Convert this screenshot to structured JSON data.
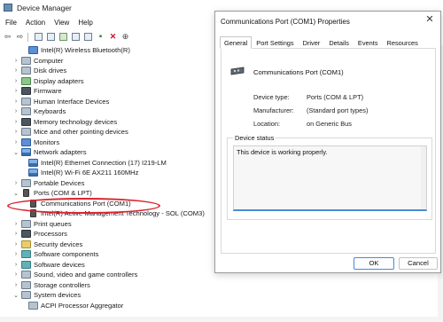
{
  "window": {
    "title": "Device Manager"
  },
  "menu": [
    "File",
    "Action",
    "View",
    "Help"
  ],
  "tree": [
    {
      "label": "Intel(R) Wireless Bluetooth(R)",
      "indent": 2,
      "icon": "bluetooth-icon"
    },
    {
      "label": "Computer",
      "indent": 1,
      "expander": "›",
      "icon": "computer-icon"
    },
    {
      "label": "Disk drives",
      "indent": 1,
      "expander": "›",
      "icon": "disk-drive-icon"
    },
    {
      "label": "Display adapters",
      "indent": 1,
      "expander": "›",
      "icon": "display-adapter-icon"
    },
    {
      "label": "Firmware",
      "indent": 1,
      "expander": "›",
      "icon": "firmware-icon"
    },
    {
      "label": "Human Interface Devices",
      "indent": 1,
      "expander": "›",
      "icon": "hid-icon"
    },
    {
      "label": "Keyboards",
      "indent": 1,
      "expander": "›",
      "icon": "keyboard-icon"
    },
    {
      "label": "Memory technology devices",
      "indent": 1,
      "expander": "›",
      "icon": "memory-icon"
    },
    {
      "label": "Mice and other pointing devices",
      "indent": 1,
      "expander": "›",
      "icon": "mouse-icon"
    },
    {
      "label": "Monitors",
      "indent": 1,
      "expander": "›",
      "icon": "monitor-icon"
    },
    {
      "label": "Network adapters",
      "indent": 1,
      "expander": "⌄",
      "icon": "network-adapter-icon"
    },
    {
      "label": "Intel(R) Ethernet Connection (17) I219-LM",
      "indent": 2,
      "icon": "network-adapter-icon"
    },
    {
      "label": "Intel(R) Wi-Fi 6E AX211 160MHz",
      "indent": 2,
      "icon": "network-adapter-icon"
    },
    {
      "label": "Portable Devices",
      "indent": 1,
      "expander": "›",
      "icon": "portable-device-icon"
    },
    {
      "label": "Ports (COM & LPT)",
      "indent": 1,
      "expander": "⌄",
      "icon": "port-icon"
    },
    {
      "label": "Communications Port (COM1)",
      "indent": 2,
      "icon": "port-icon"
    },
    {
      "label": "Intel(R) Active Management Technology - SOL (COM3)",
      "indent": 2,
      "icon": "port-icon"
    },
    {
      "label": "Print queues",
      "indent": 1,
      "expander": "›",
      "icon": "printer-icon"
    },
    {
      "label": "Processors",
      "indent": 1,
      "expander": "›",
      "icon": "processor-icon"
    },
    {
      "label": "Security devices",
      "indent": 1,
      "expander": "›",
      "icon": "security-icon"
    },
    {
      "label": "Software components",
      "indent": 1,
      "expander": "›",
      "icon": "software-component-icon"
    },
    {
      "label": "Software devices",
      "indent": 1,
      "expander": "›",
      "icon": "software-device-icon"
    },
    {
      "label": "Sound, video and game controllers",
      "indent": 1,
      "expander": "›",
      "icon": "sound-icon"
    },
    {
      "label": "Storage controllers",
      "indent": 1,
      "expander": "›",
      "icon": "storage-controller-icon"
    },
    {
      "label": "System devices",
      "indent": 1,
      "expander": "⌄",
      "icon": "system-device-icon"
    },
    {
      "label": "ACPI Processor Aggregator",
      "indent": 2,
      "icon": "system-device-icon"
    }
  ],
  "dialog": {
    "title": "Communications Port (COM1) Properties",
    "tabs": [
      "General",
      "Port Settings",
      "Driver",
      "Details",
      "Events",
      "Resources"
    ],
    "device_name": "Communications Port (COM1)",
    "properties": [
      {
        "label": "Device type:",
        "value": "Ports (COM & LPT)"
      },
      {
        "label": "Manufacturer:",
        "value": "(Standard port types)"
      },
      {
        "label": "Location:",
        "value": "on Generic Bus"
      }
    ],
    "status_group_label": "Device status",
    "status_text": "This device is working properly.",
    "ok_label": "OK",
    "cancel_label": "Cancel",
    "close_glyph": "✕"
  }
}
